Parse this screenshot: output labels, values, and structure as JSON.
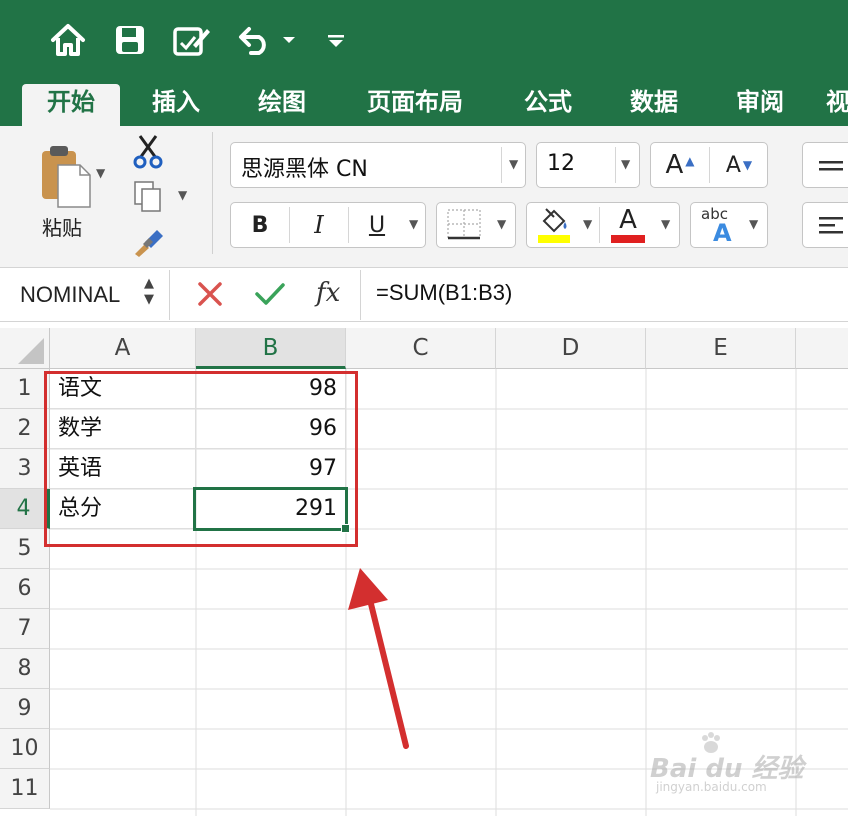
{
  "quick_access": {
    "home_icon": "home-icon",
    "save_icon": "save-icon",
    "edit_icon": "edit-document-icon",
    "undo_icon": "undo-icon",
    "customize_icon": "customize-toolbar-icon"
  },
  "tabs": [
    {
      "label": "开始",
      "active": true
    },
    {
      "label": "插入"
    },
    {
      "label": "绘图"
    },
    {
      "label": "页面布局"
    },
    {
      "label": "公式"
    },
    {
      "label": "数据"
    },
    {
      "label": "审阅"
    },
    {
      "label": "视"
    }
  ],
  "ribbon": {
    "paste_label": "粘贴",
    "font_name": "思源黑体 CN",
    "font_size": "12",
    "grow_font_label": "A",
    "shrink_font_label": "A",
    "bold_label": "B",
    "italic_label": "I",
    "underline_label": "U",
    "font_color_label": "A",
    "text_effects_label": "abc",
    "text_effects_sub": "A",
    "highlight_color": "#ffff00",
    "font_color": "#e02020"
  },
  "formula_bar": {
    "name_box": "NOMINAL",
    "fx_label": "fx",
    "formula": "=SUM(B1:B3)"
  },
  "grid": {
    "columns": [
      "A",
      "B",
      "C",
      "D",
      "E"
    ],
    "rows": [
      "1",
      "2",
      "3",
      "4",
      "5",
      "6",
      "7",
      "8",
      "9",
      "10",
      "11"
    ],
    "cells": [
      {
        "A": "语文",
        "B": "98"
      },
      {
        "A": "数学",
        "B": "96"
      },
      {
        "A": "英语",
        "B": "97"
      },
      {
        "A": "总分",
        "B": "291"
      }
    ],
    "active_cell": "B4"
  },
  "watermark": {
    "brand": "Bai du 经验",
    "url": "jingyan.baidu.com"
  },
  "colors": {
    "accent": "#217346",
    "annotation": "#d32f2f"
  }
}
